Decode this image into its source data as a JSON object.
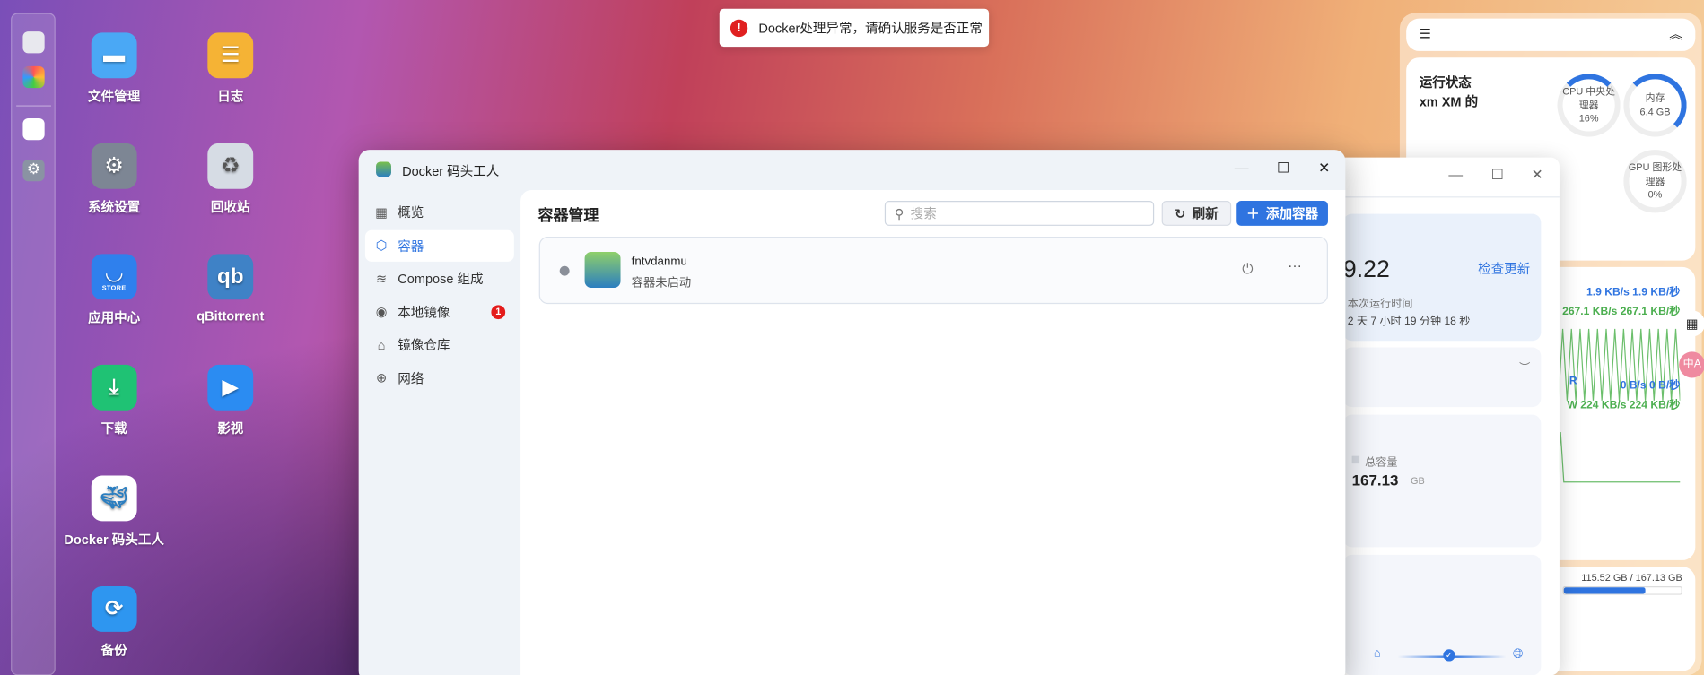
{
  "desktop": {
    "icons": [
      {
        "label": "文件管理",
        "icon": "folder-icon",
        "color": "#4aa8f5"
      },
      {
        "label": "日志",
        "icon": "log-icon",
        "color": "#f5b335"
      },
      {
        "label": "系统设置",
        "icon": "gear-icon",
        "color": "#7d8694"
      },
      {
        "label": "回收站",
        "icon": "recycle-icon",
        "color": "#d6dce4"
      },
      {
        "label": "应用中心",
        "icon": "store-icon",
        "color": "#2f80ed"
      },
      {
        "label": "qBittorrent",
        "icon": "qb-icon",
        "color": "#3f82c6"
      },
      {
        "label": "下载",
        "icon": "download-icon",
        "color": "#1fc274"
      },
      {
        "label": "影视",
        "icon": "video-icon",
        "color": "#2b8cf2"
      },
      {
        "label": "Docker 码头工人",
        "icon": "docker-icon",
        "color": "#ffffff"
      },
      {
        "label": "备份",
        "icon": "backup-icon",
        "color": "#2e96f0"
      }
    ],
    "store_sub": "STORE",
    "qb_glyph": "qb"
  },
  "toast": {
    "message": "Docker处理异常，请确认服务是否正常",
    "icon": "!"
  },
  "widget": {
    "status_title": "运行状态",
    "device": "xm  XM 的",
    "cpu": {
      "label": "CPU  中央处理器",
      "value": "16%",
      "fraction": 0.16
    },
    "memory": {
      "label": "内存",
      "value": "6.4 GB",
      "fraction": 0.2
    },
    "gpu": {
      "label": "GPU  图形处理器",
      "value": "0%",
      "fraction": 0
    },
    "net_up": "1.9 KB/s  1.9 KB/秒",
    "net_down": "267.1 KB/s  267.1 KB/秒",
    "disk_r_label": "R",
    "disk_r": "0 B/s  0 B/秒",
    "disk_w": "W 224 KB/s  224 KB/秒",
    "storage": "115.52 GB / 167.13 GB",
    "storage_fraction": 0.69,
    "sec": "秒"
  },
  "back_window": {
    "version": "9.22",
    "check_update": "检查更新",
    "uptime_label": "本次运行时间",
    "uptime": "2 天 7 小时 19 分钟 18 秒",
    "total_label": "总容量",
    "total_value": "167.13",
    "total_unit": "GB"
  },
  "docker": {
    "title": "Docker  码头工人",
    "nav": [
      {
        "label": "概览",
        "icon": "grid-icon"
      },
      {
        "label": "容器",
        "icon": "cube-icon"
      },
      {
        "label": "Compose   组成",
        "icon": "layers-icon"
      },
      {
        "label": "本地镜像",
        "icon": "image-icon",
        "badge": "1"
      },
      {
        "label": "镜像仓库",
        "icon": "home-icon"
      },
      {
        "label": "网络",
        "icon": "globe-icon"
      }
    ],
    "page_title": "容器管理",
    "search_placeholder": "搜索",
    "refresh": "刷新",
    "add": "添加容器",
    "containers": [
      {
        "name": "fntvdanmu",
        "status": "容器未启动"
      }
    ]
  }
}
